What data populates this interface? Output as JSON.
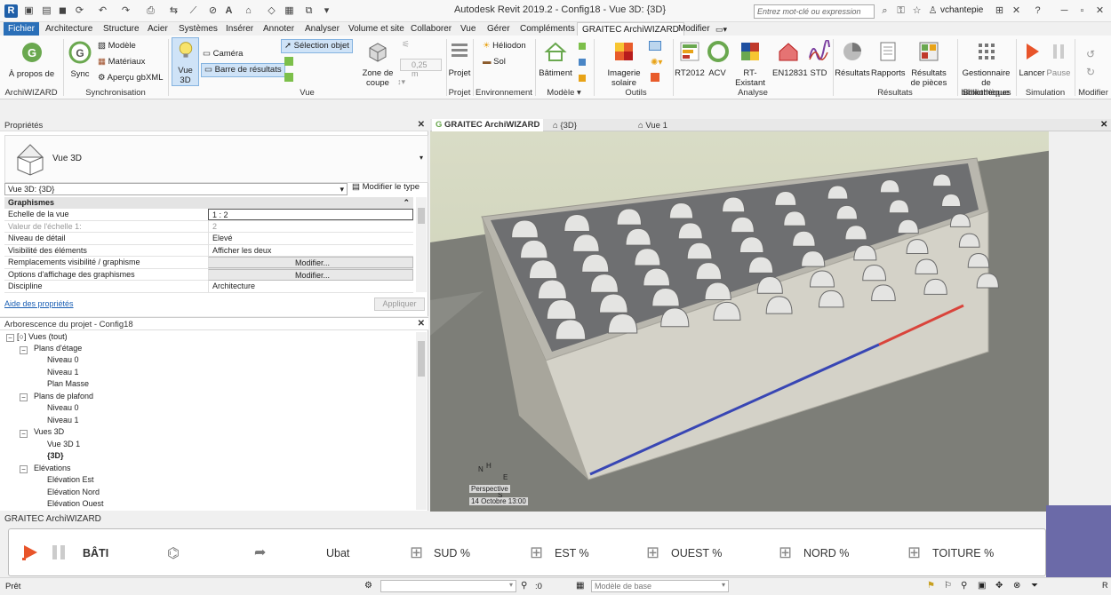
{
  "app_title": "Autodesk Revit 2019.2 - Config18 - Vue 3D: {3D}",
  "search": {
    "placeholder": "Entrez mot-clé ou expression"
  },
  "user": "vchantepie",
  "tabs": [
    "Fichier",
    "Architecture",
    "Structure",
    "Acier",
    "Systèmes",
    "Insérer",
    "Annoter",
    "Analyser",
    "Volume et site",
    "Collaborer",
    "Vue",
    "Gérer",
    "Compléments",
    "GRAITEC ArchiWIZARD",
    "Modifier"
  ],
  "ribbon": {
    "apropos": "À propos de",
    "sync": "Sync",
    "modele": "Modèle",
    "materiaux": "Matériaux",
    "apercu": "Aperçu gbXML",
    "vue3d": "Vue 3D",
    "camera": "Caméra",
    "barre": "Barre de résultats",
    "selection": "Sélection objet",
    "zone": "Zone de coupe",
    "zone_value": "0,25 m",
    "projet": "Projet",
    "heliodon": "Héliodon",
    "sol": "Sol",
    "batiment": "Bâtiment",
    "imagerie": "Imagerie solaire",
    "rt2012": "RT2012",
    "acv": "ACV",
    "rtexistant": "RT-Existant",
    "en12831": "EN12831",
    "std": "STD",
    "resultats": "Résultats",
    "rapports": "Rapports",
    "resultats_pieces": "Résultats de pièces",
    "gestionnaire": "Gestionnaire de bibliothèques",
    "lancer": "Lancer",
    "pause": "Pause",
    "groups": {
      "archiwizard": "ArchiWIZARD",
      "sync": "Synchronisation",
      "vue": "Vue",
      "projet": "Projet",
      "env": "Environnement",
      "modele": "Modèle",
      "outils": "Outils",
      "analyse": "Analyse",
      "resultats": "Résultats",
      "biblio": "Bibliothèque",
      "simulation": "Simulation",
      "modifier": "Modifier"
    }
  },
  "properties": {
    "title": "Propriétés",
    "type_name": "Vue 3D",
    "selector": "Vue 3D: {3D}",
    "edit_type": "Modifier le type",
    "section": "Graphismes",
    "rows": [
      {
        "k": "Echelle de la vue",
        "v": "1 : 2"
      },
      {
        "k": "Valeur de l'échelle    1:",
        "v": "2"
      },
      {
        "k": "Niveau de détail",
        "v": "Elevé"
      },
      {
        "k": "Visibilité des éléments",
        "v": "Afficher les deux"
      },
      {
        "k": "Remplacements visibilité / graphisme",
        "v": "Modifier..."
      },
      {
        "k": "Options d'affichage des graphismes",
        "v": "Modifier..."
      },
      {
        "k": "Discipline",
        "v": "Architecture"
      }
    ],
    "help": "Aide des propriétés",
    "apply": "Appliquer"
  },
  "browser": {
    "title": "Arborescence du projet - Config18",
    "items": [
      "Vues (tout)",
      "Plans d'étage",
      "Niveau 0",
      "Niveau 1",
      "Plan Masse",
      "Plans de plafond",
      "Niveau 0",
      "Niveau 1",
      "Vues 3D",
      "Vue 3D 1",
      "{3D}",
      "Elévations",
      "Elévation Est",
      "Elévation Nord",
      "Elévation Ouest"
    ]
  },
  "view_tabs": [
    "GRAITEC ArchiWIZARD",
    "{3D}",
    "Vue 1"
  ],
  "viewcube": {
    "n": "N",
    "h": "H",
    "e": "E",
    "s": "S",
    "perspective": "Perspective",
    "date": "14 Octobre 13:00"
  },
  "wizard": {
    "title": "GRAITEC ArchiWIZARD",
    "bati": "BÂTI",
    "ubat": "Ubat",
    "sud": "SUD  %",
    "est": "EST  %",
    "ouest": "OUEST  %",
    "nord": "NORD  %",
    "toiture": "TOITURE  %"
  },
  "status": {
    "ready": "Prêt",
    "zero": ":0",
    "model": "Modèle de base"
  },
  "colors": {
    "accent": "#2a6fb8",
    "play": "#e8542a",
    "purple_block": "#6b6aa8"
  }
}
